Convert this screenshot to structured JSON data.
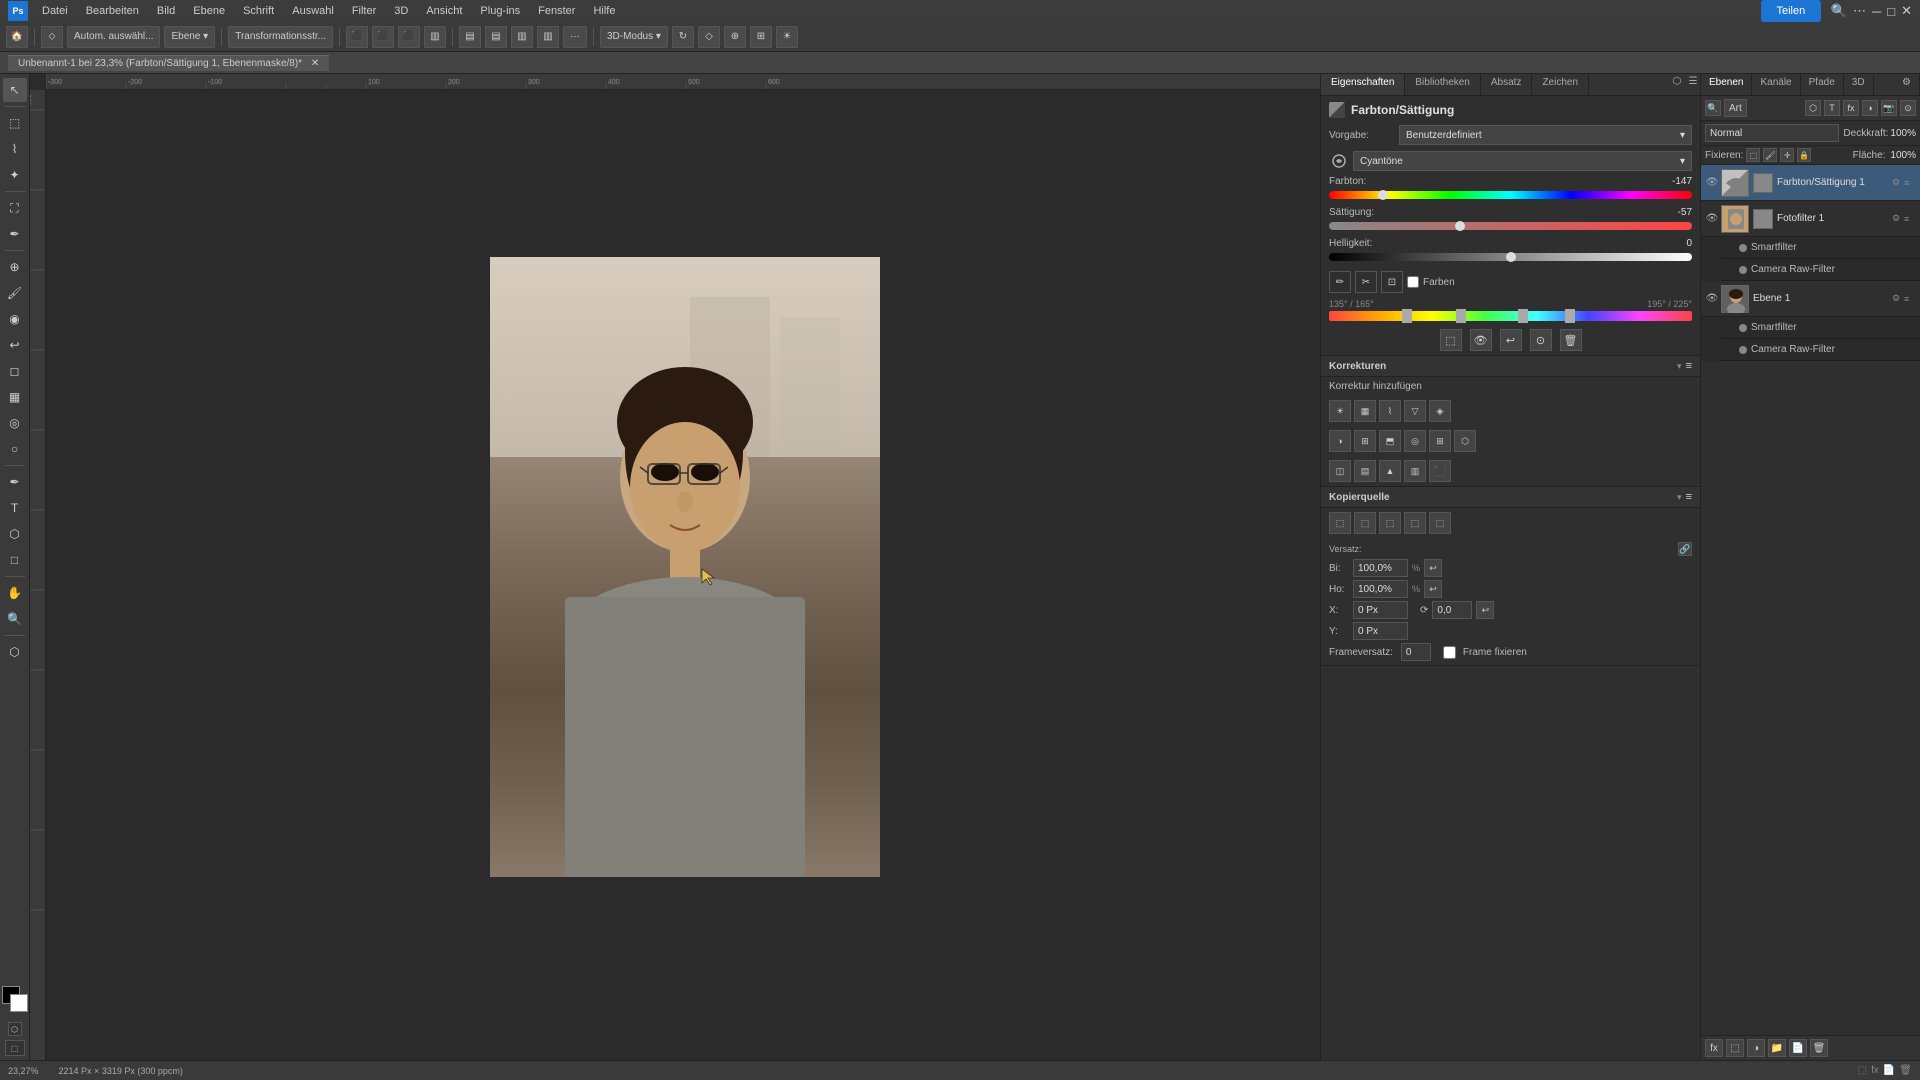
{
  "app": {
    "title": "Adobe Photoshop",
    "logo": "Ps"
  },
  "menubar": {
    "items": [
      "Datei",
      "Bearbeiten",
      "Bild",
      "Ebene",
      "Schrift",
      "Auswahl",
      "Filter",
      "3D",
      "Ansicht",
      "Plug-ins",
      "Fenster",
      "Hilfe"
    ]
  },
  "toolbar_top": {
    "auto_btn": "Autom. auswähl...",
    "layer_btn": "Ebene ▾",
    "transform_btn": "Transformationsstr...",
    "more_btn": "···",
    "share_btn": "Teilen"
  },
  "doc_tab": {
    "title": "Unbenannt-1 bei 23,3% (Farbton/Sättigung 1, Ebenenmaske/8)*"
  },
  "properties_panel": {
    "tabs": [
      "Eigenschaften",
      "Bibliotheken",
      "Absatz",
      "Zeichen"
    ],
    "active_tab": "Eigenschaften",
    "section_title": "Farbton/Sättigung",
    "vorgabe_label": "Vorgabe:",
    "vorgabe_value": "Benutzerdefiniert",
    "channel_value": "Cyantöne",
    "farbton_label": "Farbton:",
    "farbton_value": "-147",
    "sattigung_label": "Sättigung:",
    "sattigung_value": "-57",
    "helligkeit_label": "Helligkeit:",
    "helligkeit_value": "0",
    "farben_label": "Farben",
    "range_left": "135° / 165°",
    "range_right": "195° / 225°"
  },
  "korrekturen_panel": {
    "title": "Korrekturen",
    "subtitle": "Korrektur hinzufügen"
  },
  "kopierquelle_panel": {
    "title": "Kopierquelle",
    "versatz_label": "Versatz:",
    "bi_label": "Bi:",
    "bi_value": "100,0%",
    "ho_label": "Ho:",
    "ho_value": "100,0%",
    "x_label": "X:",
    "x_value": "0 Px",
    "y_label": "Y:",
    "y_value": "0 Px",
    "rotation_label": "Drehung:",
    "rotation_value": "0,0",
    "frameversatz_label": "Frameversatz:",
    "frameversatz_value": "0",
    "frame_frozen_label": "Frame fixieren"
  },
  "layers_panel": {
    "tabs": [
      "Ebenen",
      "Kanäle",
      "Pfade",
      "3D"
    ],
    "active_tab": "Ebenen",
    "search_placeholder": "Art",
    "mode": "Normal",
    "opacity_label": "Deckkraft:",
    "opacity_value": "100%",
    "flache_label": "Fläche:",
    "flache_value": "100%",
    "fixieren_label": "Fixieren:",
    "layers": [
      {
        "name": "Farbton/Sättigung 1",
        "type": "adjustment",
        "visible": true,
        "active": true,
        "has_mask": true
      },
      {
        "name": "Fotofilter 1",
        "type": "adjustment",
        "visible": true,
        "active": false,
        "has_mask": true,
        "sub": [
          {
            "name": "Smartfilter"
          },
          {
            "name": "Camera Raw-Filter"
          }
        ]
      },
      {
        "name": "Ebene 1",
        "type": "normal",
        "visible": true,
        "active": false,
        "sub": [
          {
            "name": "Smartfilter"
          },
          {
            "name": "Camera Raw-Filter"
          }
        ]
      }
    ]
  },
  "statusbar": {
    "zoom": "23,27%",
    "dimensions": "2214 Px × 3319 Px (300 ppcm)"
  },
  "icons": {
    "eye": "👁",
    "arrow_down": "▾",
    "arrow_right": "▸",
    "close": "✕",
    "lock": "🔒",
    "chain": "⛓",
    "fx": "fx",
    "add": "+",
    "trash": "🗑",
    "new_layer": "📄",
    "folder": "📁",
    "mask": "⬜",
    "adjust": "◑"
  }
}
